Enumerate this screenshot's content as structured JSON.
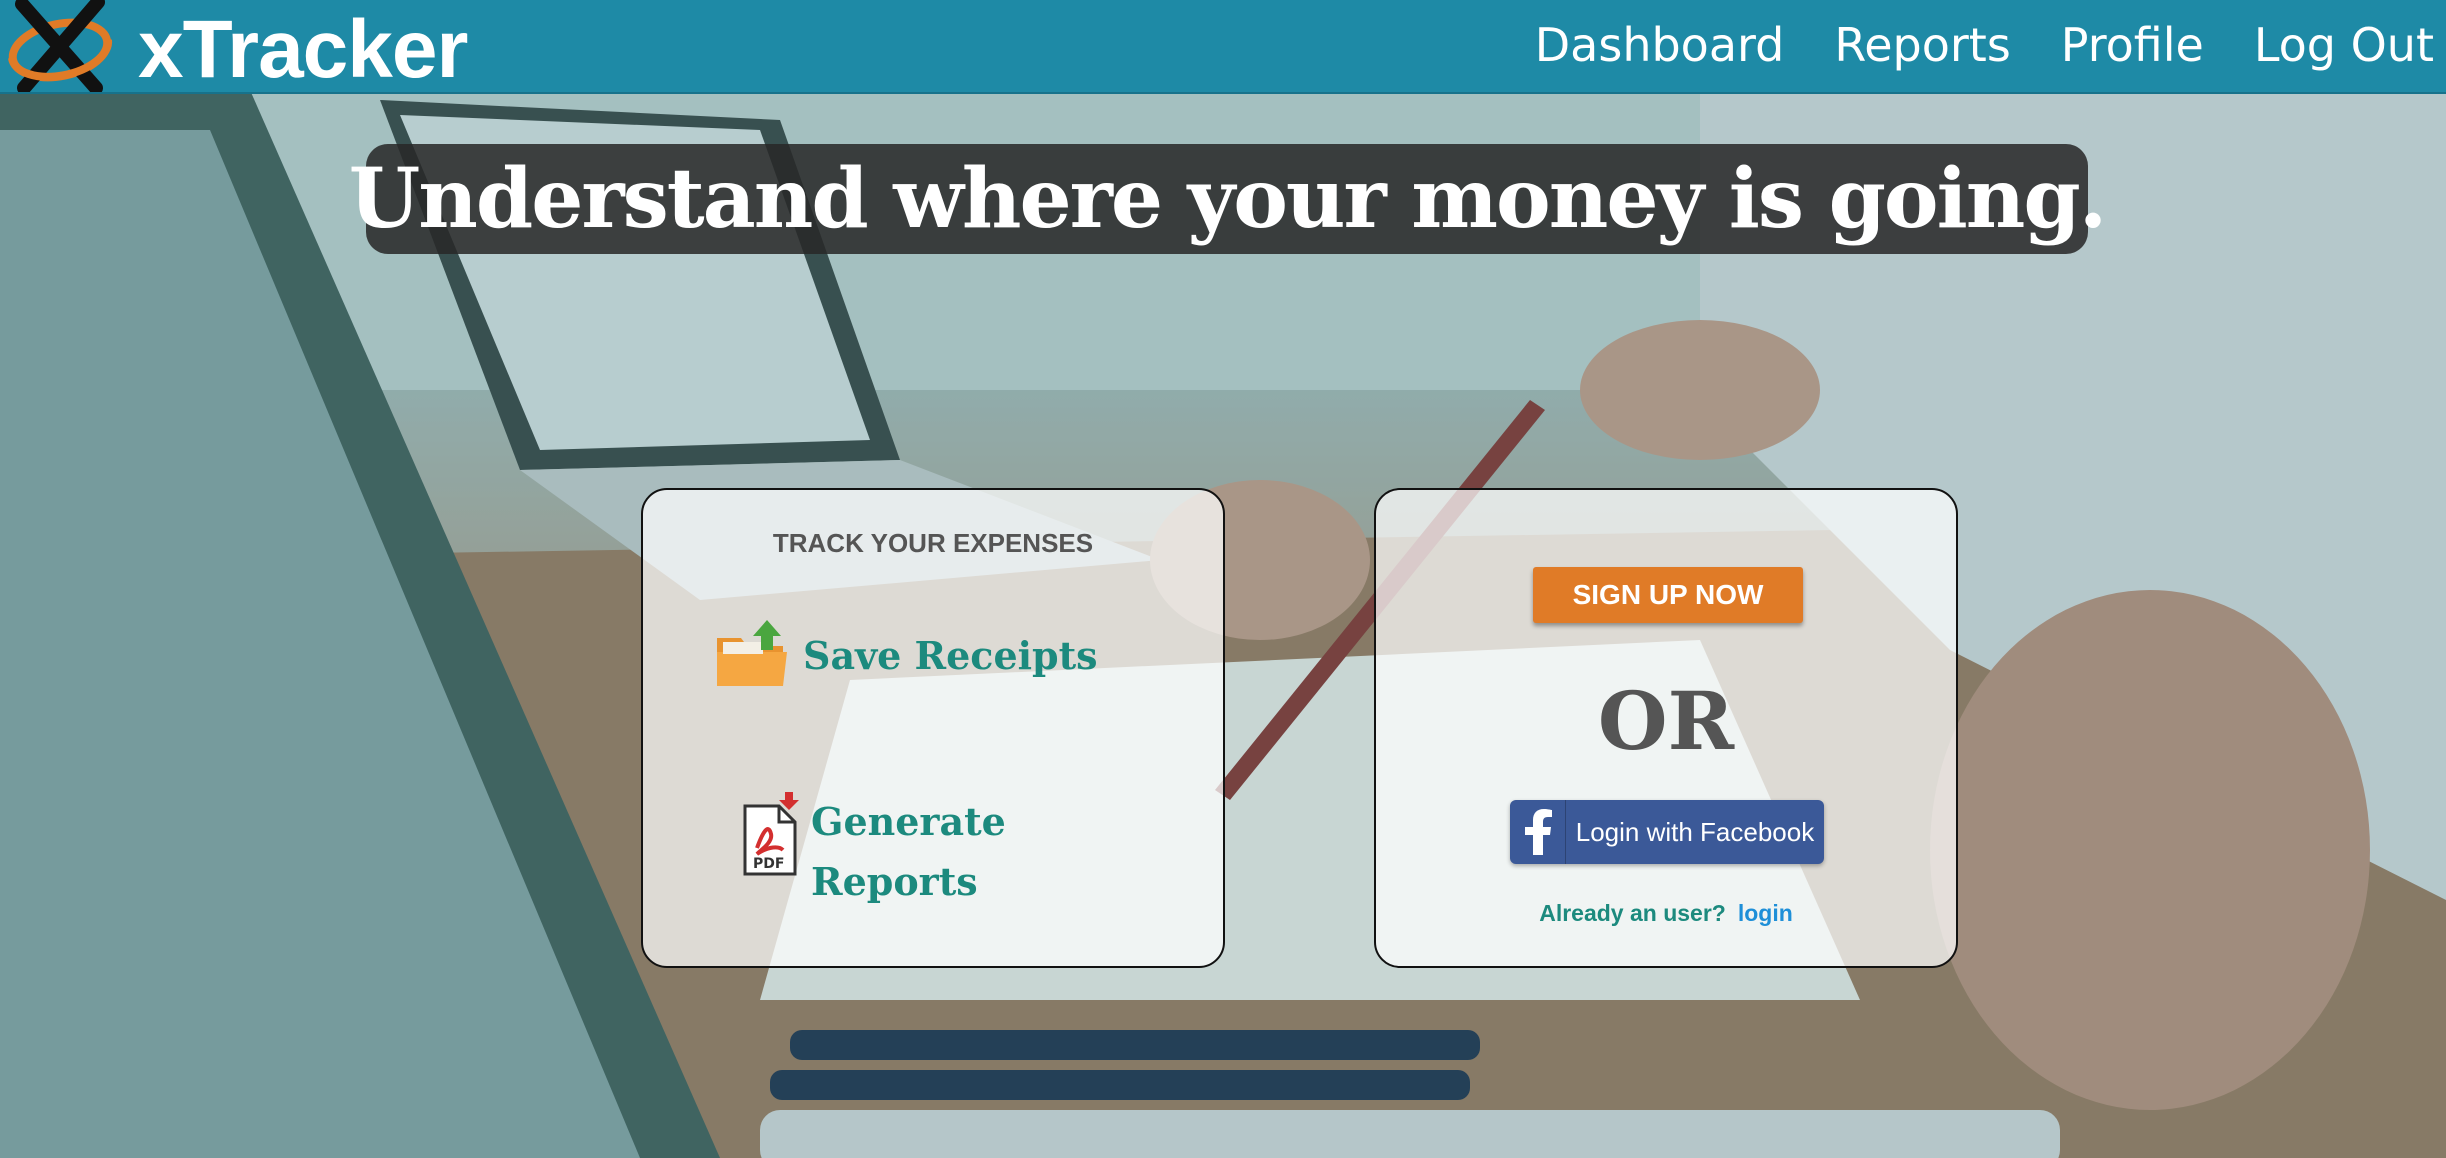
{
  "app": {
    "brand": "xTracker",
    "logo_icon": "x-orbit-logo-icon",
    "accent_color": "#1e8aa6"
  },
  "nav": {
    "items": [
      {
        "label": "Dashboard"
      },
      {
        "label": "Reports"
      },
      {
        "label": "Profile"
      },
      {
        "label": "Log Out"
      }
    ]
  },
  "hero": {
    "headline": "Understand where your money is going."
  },
  "features_card": {
    "heading": "TRACK YOUR EXPENSES",
    "items": [
      {
        "label": "Save Receipts",
        "icon": "folder-upload-icon"
      },
      {
        "label": "Generate Reports",
        "icon": "pdf-download-icon"
      }
    ]
  },
  "signup_card": {
    "signup_label": "SIGN UP NOW",
    "signup_color": "#e07b27",
    "or_text": "OR",
    "facebook_label": "Login with Facebook",
    "facebook_icon": "facebook-icon",
    "facebook_color": "#3b5998",
    "already_text": "Already an user?",
    "login_label": "login"
  }
}
